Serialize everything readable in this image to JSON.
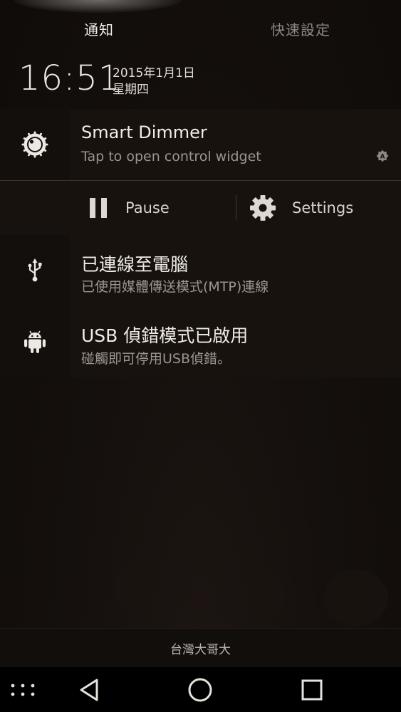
{
  "tabs": {
    "notifications": "通知",
    "quick_settings": "快速設定"
  },
  "header": {
    "time": "16:51",
    "date": "2015年1月1日",
    "weekday": "星期四"
  },
  "notifications": {
    "dimmer": {
      "icon": "dial-icon",
      "title": "Smart Dimmer",
      "text": "Tap to open control widget",
      "badge_icon": "auto-brightness-icon"
    },
    "dimmer_actions": {
      "pause_label": "Pause",
      "pause_icon": "pause-icon",
      "settings_label": "Settings",
      "settings_icon": "gear-icon"
    },
    "usb": {
      "icon": "usb-icon",
      "title": "已連線至電腦",
      "text": "已使用媒體傳送模式(MTP)連線"
    },
    "debug": {
      "icon": "android-icon",
      "title": "USB 偵錯模式已啟用",
      "text": "碰觸即可停用USB偵錯。"
    }
  },
  "carrier": "台灣大哥大",
  "navbar": {
    "buttons": [
      "menu-icon",
      "back-icon",
      "home-icon",
      "recents-icon"
    ]
  },
  "colors": {
    "background": "#120e0c",
    "card": "#18120f",
    "icon_cell": "#130f0d",
    "primary_text": "#efebe6",
    "secondary_text": "#9b958e"
  }
}
